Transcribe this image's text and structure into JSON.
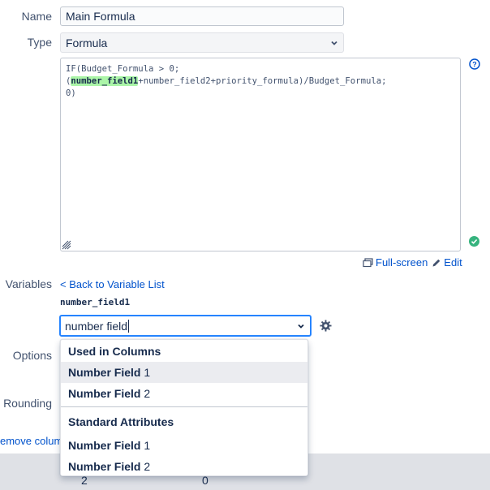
{
  "name_field": {
    "label": "Name",
    "value": "Main Formula"
  },
  "type_field": {
    "label": "Type",
    "value": "Formula"
  },
  "formula": {
    "line1": "IF(Budget_Formula > 0;",
    "line2_open": "(",
    "line2_highlight": "number_field1",
    "line2_rest": "+number_field2+priority_formula)/Budget_Formula;",
    "line3": "0)"
  },
  "editor_actions": {
    "fullscreen": "Full-screen",
    "edit": "Edit"
  },
  "variables": {
    "label": "Variables",
    "back_link": "< Back to Variable List",
    "current_variable": "number_field1",
    "search_value": "number field"
  },
  "dropdown": {
    "groups": [
      {
        "title": "Used in Columns",
        "options": [
          {
            "match": "Number Field",
            "rest": " 1"
          },
          {
            "match": "Number Field",
            "rest": " 2"
          }
        ]
      },
      {
        "title": "Standard Attributes",
        "options": [
          {
            "match": "Number Field",
            "rest": " 1"
          },
          {
            "match": "Number Field",
            "rest": " 2"
          }
        ]
      }
    ]
  },
  "side_labels": {
    "options": "Options",
    "rounding": "Rounding",
    "remove_column": "emove colum"
  },
  "bottom_row": {
    "col1": "2",
    "col2": "0"
  },
  "colors": {
    "accent": "#2684ff",
    "link": "#0052cc",
    "highlight": "#abf5a8",
    "success": "#36b37e"
  }
}
